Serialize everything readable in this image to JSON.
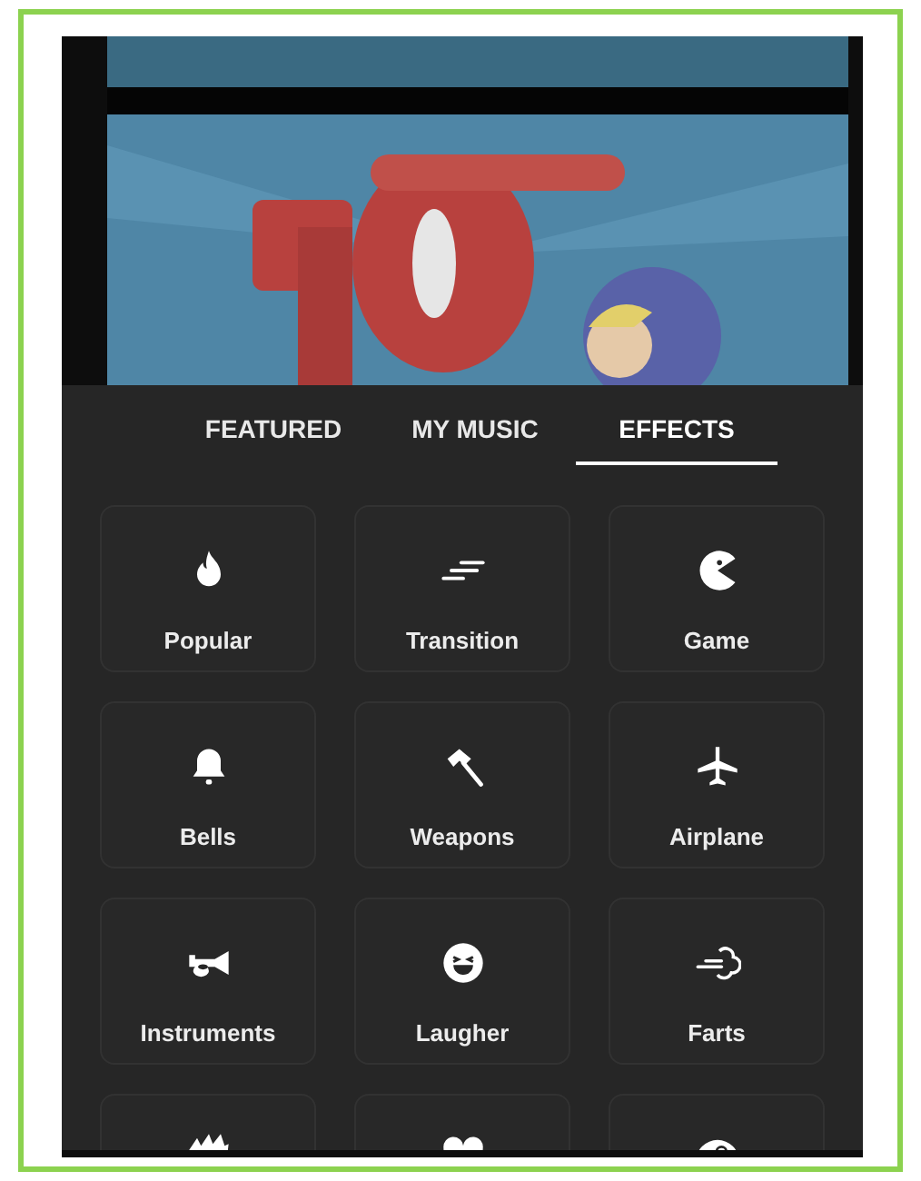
{
  "tabs": [
    {
      "label": "FEATURED",
      "selected": false
    },
    {
      "label": "MY MUSIC",
      "selected": false
    },
    {
      "label": "EFFECTS",
      "selected": true
    }
  ],
  "categories": [
    {
      "label": "Popular"
    },
    {
      "label": "Transition"
    },
    {
      "label": "Game"
    },
    {
      "label": "Bells"
    },
    {
      "label": "Weapons"
    },
    {
      "label": "Airplane"
    },
    {
      "label": "Instruments"
    },
    {
      "label": "Laugher"
    },
    {
      "label": "Farts"
    }
  ]
}
